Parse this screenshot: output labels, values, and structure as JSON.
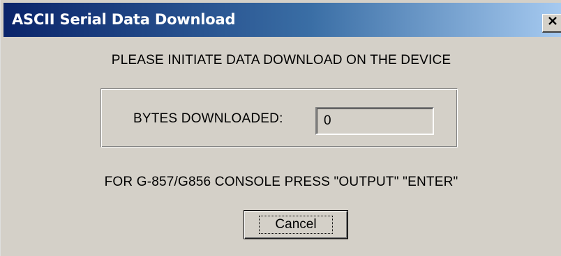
{
  "window": {
    "title": "ASCII Serial Data Download",
    "close_glyph": "✕"
  },
  "dialog": {
    "prompt": "PLEASE INITIATE DATA DOWNLOAD ON THE DEVICE",
    "bytes_label": "BYTES DOWNLOADED:",
    "bytes_value": "0",
    "instruction": "FOR G-857/G856 CONSOLE PRESS \"OUTPUT\" \"ENTER\"",
    "cancel_label": "Cancel"
  },
  "icons": {
    "close": "close-icon"
  },
  "colors": {
    "dialog_face": "#d4d0c8",
    "title_active_start": "#0a246a",
    "title_active_end": "#a6caf0"
  }
}
